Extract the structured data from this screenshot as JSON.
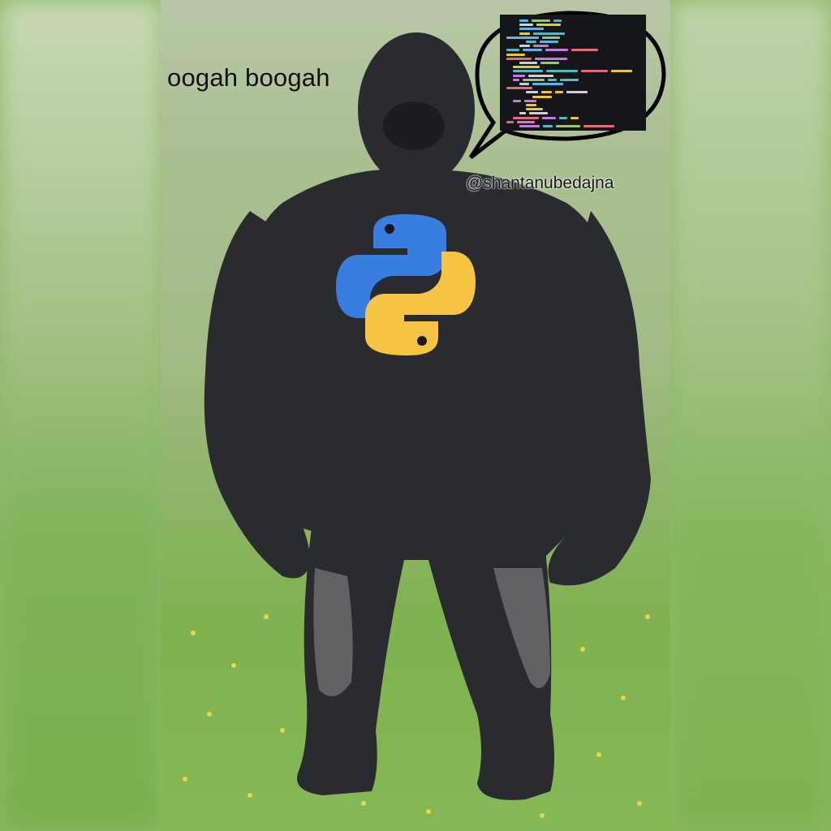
{
  "caption": "oogah boogah",
  "handle": "@shantanubedajna",
  "logo": {
    "name": "python-logo",
    "blue": "#3a7de0",
    "yellow": "#f6c343"
  },
  "colors": {
    "fur": "#2a2b2e",
    "grass": "#7fb24f",
    "background": "#b7c7a6",
    "code_bg": "#14161a"
  }
}
